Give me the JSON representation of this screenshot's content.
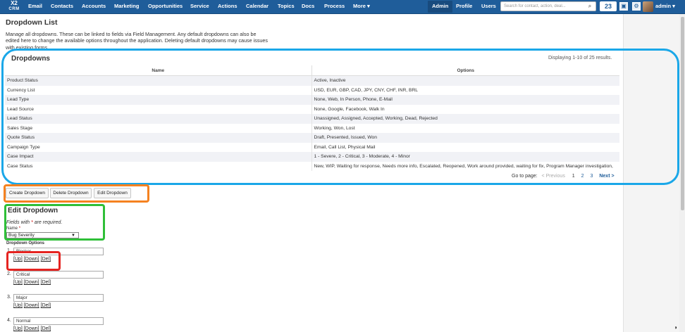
{
  "nav": {
    "logo_line1": "X2",
    "logo_line2": "CRM",
    "items": [
      "Email",
      "Contacts",
      "Accounts",
      "Marketing",
      "Opportunities",
      "Service",
      "Actions",
      "Calendar",
      "Topics",
      "Docs",
      "Process",
      "More ▾"
    ],
    "admin": "Admin",
    "profile": "Profile",
    "users": "Users",
    "search_placeholder": "Search for contact, action, deal...",
    "notification_count": "23",
    "user_name": "admin ▾"
  },
  "page": {
    "title": "Dropdown List",
    "description": "Manage all dropdowns. These can be linked to fields via Field Management. Any default dropdowns can also be edited here to change the available options throughout the application. Deleting default dropdowns may cause issues with existing forms."
  },
  "grid": {
    "title": "Dropdowns",
    "count_text": "Displaying 1-10 of 25 results.",
    "columns": [
      "Name",
      "Options"
    ],
    "rows": [
      [
        "Product Status",
        "Active, Inactive"
      ],
      [
        "Currency List",
        "USD, EUR, GBP, CAD, JPY, CNY, CHF, INR, BRL"
      ],
      [
        "Lead Type",
        "None, Web, In Person, Phone, E-Mail"
      ],
      [
        "Lead Source",
        "None, Google, Facebook, Walk In"
      ],
      [
        "Lead Status",
        "Unassigned, Assigned, Accepted, Working, Dead, Rejected"
      ],
      [
        "Sales Stage",
        "Working, Won, Lost"
      ],
      [
        "Quote Status",
        "Draft, Presented, Issued, Won"
      ],
      [
        "Campaign Type",
        "Email, Call List, Physical Mail"
      ],
      [
        "Case Impact",
        "1 - Severe, 2 - Critical, 3 - Moderate, 4 - Minor"
      ],
      [
        "Case Status",
        "New, WIP, Waiting for response, Needs more info, Escalated, Reopened, Work around provided, waiting for fix, Program Manager investigation,"
      ]
    ],
    "pager": {
      "label": "Go to page:",
      "prev": "< Previous",
      "pages": [
        "1",
        "2",
        "3"
      ],
      "next": "Next >"
    }
  },
  "buttons": {
    "create": "Create Dropdown",
    "delete": "Delete Dropdown",
    "edit": "Edit Dropdown"
  },
  "edit_form": {
    "title": "Edit Dropdown",
    "required_note_pre": "Fields with ",
    "required_star": "*",
    "required_note_post": " are required.",
    "name_label": "Name",
    "name_value": "Bug Severity",
    "options_label": "Dropdown Options",
    "options": [
      {
        "num": "1.",
        "value": "Blocker"
      },
      {
        "num": "2.",
        "value": "Critical"
      },
      {
        "num": "3.",
        "value": "Major"
      },
      {
        "num": "4.",
        "value": "Normal"
      }
    ],
    "link_up": "[Up]",
    "link_down": "[Down]",
    "link_del": "[Del]"
  },
  "colors": {
    "nav_bg": "#1f5d9a",
    "highlight_blue": "#1aa7e8",
    "highlight_orange": "#f58220",
    "highlight_green": "#2fbf38",
    "highlight_red": "#e52421"
  },
  "icons": [
    "search-icon",
    "notification-icon",
    "window-icon",
    "gear-icon",
    "contrast-icon"
  ]
}
